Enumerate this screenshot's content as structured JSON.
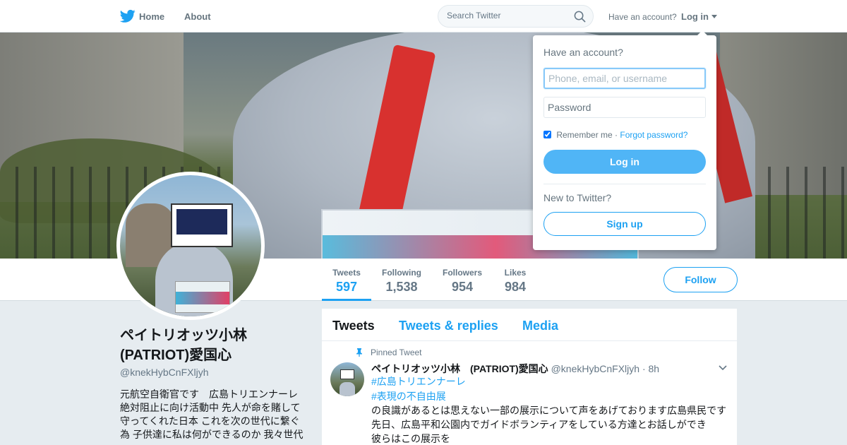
{
  "nav": {
    "home_label": "Home",
    "about_label": "About",
    "search_placeholder": "Search Twitter",
    "have_account": "Have an account?",
    "login_label": "Log in"
  },
  "login_dropdown": {
    "title": "Have an account?",
    "username_placeholder": "Phone, email, or username",
    "password_placeholder": "Password",
    "remember_label": "Remember me",
    "separator": " · ",
    "forgot_label": "Forgot password?",
    "login_button": "Log in",
    "new_prompt": "New to Twitter?",
    "signup_button": "Sign up"
  },
  "stats": [
    {
      "label": "Tweets",
      "value": "597"
    },
    {
      "label": "Following",
      "value": "1,538"
    },
    {
      "label": "Followers",
      "value": "954"
    },
    {
      "label": "Likes",
      "value": "984"
    }
  ],
  "follow_button": "Follow",
  "profile": {
    "name_line1": "ペイトリオッツ小林",
    "name_line2": "(PATRIOT)愛国心",
    "handle": "@knekHybCnFXljyh",
    "bio_lines": [
      "元航空自衛官です　広島トリエンナーレ",
      "絶対阻止に向け活動中 先人が命を賭して",
      "守ってくれた日本 これを次の世代に繋ぐ",
      "為 子供達に私は何ができるのか 我々世代"
    ]
  },
  "timeline": {
    "tabs": [
      "Tweets",
      "Tweets & replies",
      "Media"
    ],
    "pinned_label": "Pinned Tweet",
    "tweet": {
      "name": "ペイトリオッツ小林　(PATRIOT)愛国心",
      "handle": "@knekHybCnFXljyh",
      "time": "8h",
      "hashtags": [
        "#広島トリエンナーレ",
        "#表現の不自由展"
      ],
      "lines": [
        "の良識があるとは思えない一部の展示について声をあげております広島県民です",
        "先日、広島平和公園内でガイドボランティアをしている方達とお話しができ",
        "彼らはこの展示を"
      ]
    }
  },
  "colors": {
    "accent": "#1da1f2",
    "login_button_bg": "#50b5f6",
    "page_bg": "#e6ecf0"
  },
  "icons": [
    "twitter-bird-icon",
    "search-icon",
    "chevron-down-icon",
    "pin-icon",
    "checkbox"
  ]
}
